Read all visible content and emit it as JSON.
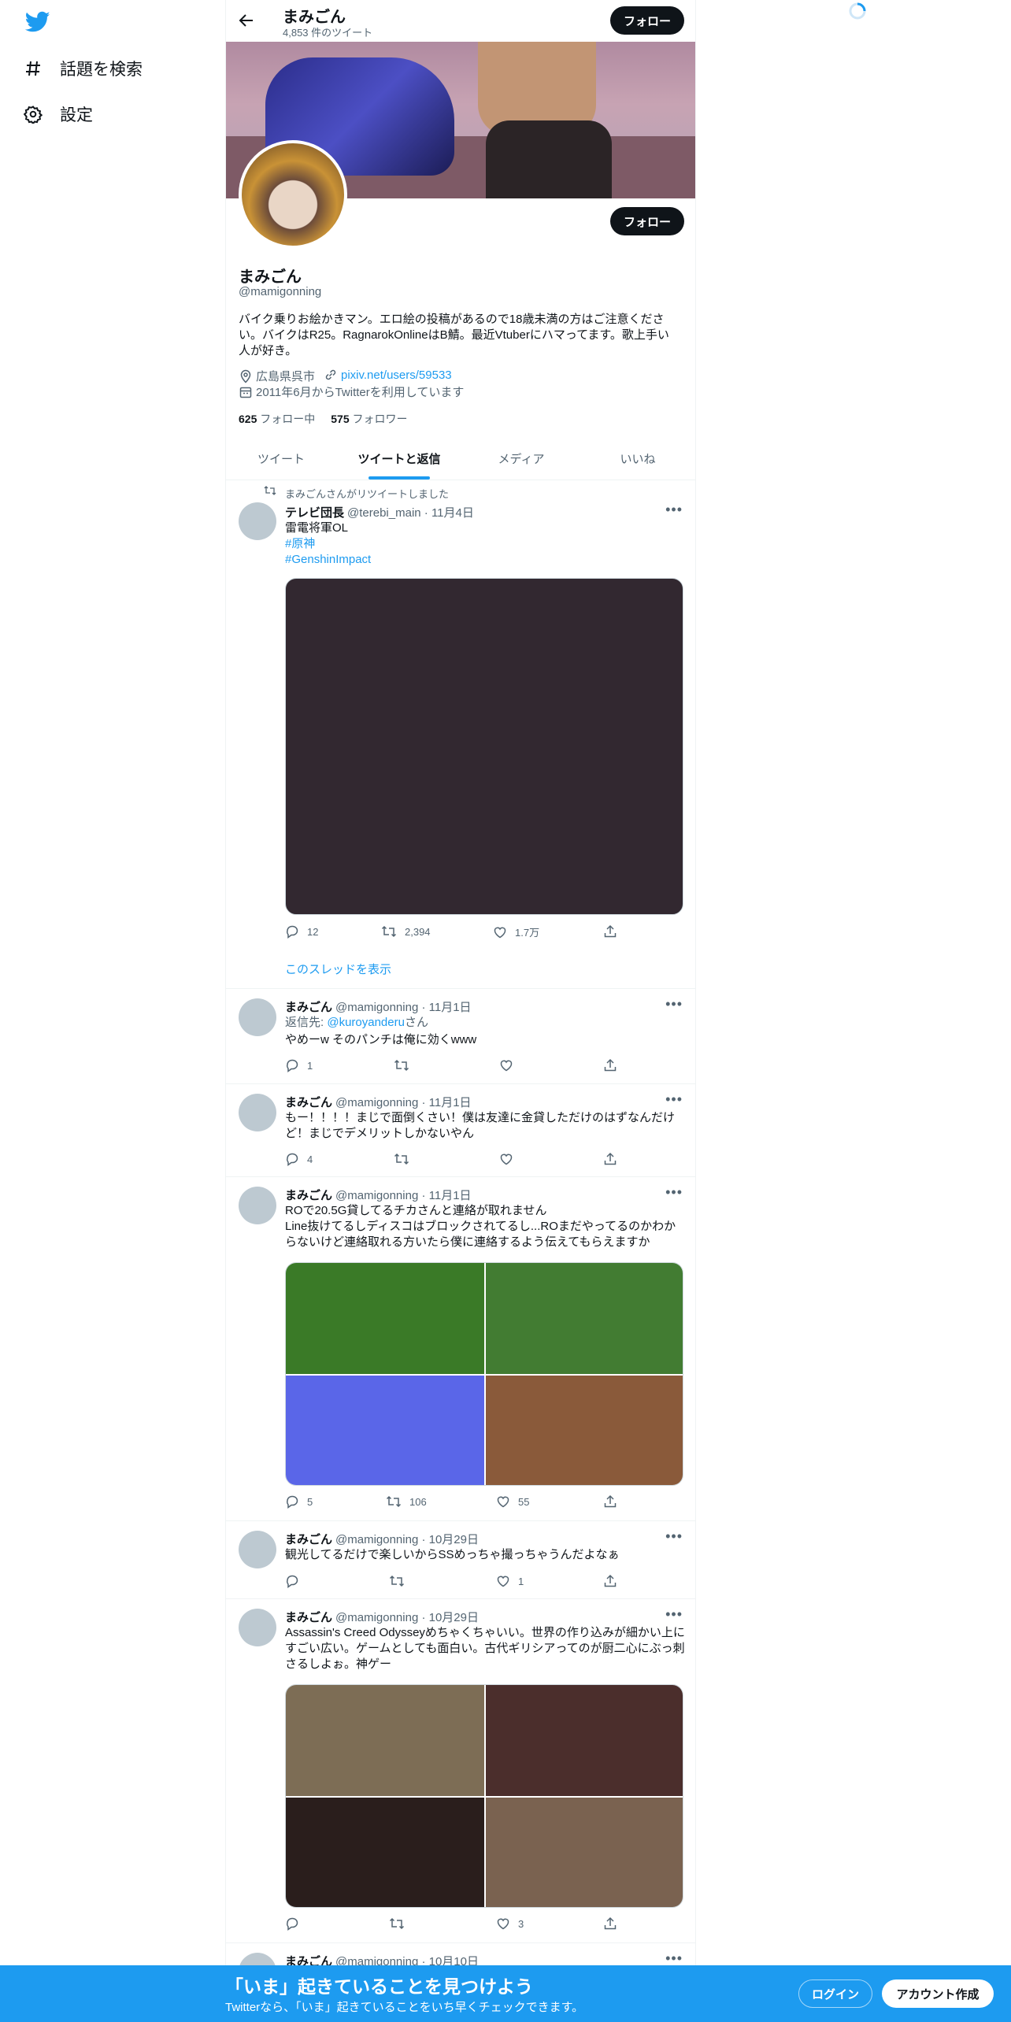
{
  "nav": {
    "explore_label": "話題を検索",
    "settings_label": "設定"
  },
  "header": {
    "name": "まみごん",
    "tweet_count": "4,853 件のツイート",
    "follow_label": "フォロー"
  },
  "profile": {
    "follow_label": "フォロー",
    "name": "まみごん",
    "handle": "@mamigonning",
    "bio": "バイク乗りお絵かきマン。エロ絵の投稿があるので18歳未満の方はご注意ください。バイクはR25。RagnarokOnlineはB鯖。最近Vtuberにハマってます。歌上手い人が好き。",
    "location": "広島県呉市",
    "link": "pixiv.net/users/59533",
    "joined": "2011年6月からTwitterを利用しています",
    "following_count": "625",
    "following_label": "フォロー中",
    "followers_count": "575",
    "followers_label": "フォロワー"
  },
  "tabs": [
    {
      "label": "ツイート",
      "active": false
    },
    {
      "label": "ツイートと返信",
      "active": true
    },
    {
      "label": "メディア",
      "active": false
    },
    {
      "label": "いいね",
      "active": false
    }
  ],
  "tweets": [
    {
      "retweet_note": "まみごんさんがリツイートしました",
      "name": "テレビ団長",
      "meta": "@terebi_main · 11月4日",
      "text_line1": "雷電将軍OL",
      "hashtag1": "#原神",
      "hashtag2": "#GenshinImpact",
      "replies": "12",
      "retweets": "2,394",
      "likes": "1.7万",
      "show_thread": "このスレッドを表示"
    },
    {
      "name": "まみごん",
      "meta": "@mamigonning · 11月1日",
      "reply_prefix": "返信先: ",
      "reply_to": "@kuroyanderu",
      "reply_suffix": "さん",
      "text": "やめーw そのパンチは俺に効くwww",
      "replies": "1",
      "retweets": "",
      "likes": ""
    },
    {
      "name": "まみごん",
      "meta": "@mamigonning · 11月1日",
      "text": "もー！！！！まじで面倒くさい！僕は友達に金貸しただけのはずなんだけど！まじでデメリットしかないやん",
      "replies": "4",
      "retweets": "",
      "likes": ""
    },
    {
      "name": "まみごん",
      "meta": "@mamigonning · 11月1日",
      "text_line1": "ROで20.5G貸してるチカさんと連絡が取れません",
      "text_line2": "Line抜けてるしディスコはブロックされてるし...ROまだやってるのかわからないけど連絡取れる方いたら僕に連絡するよう伝えてもらえますか",
      "replies": "5",
      "retweets": "106",
      "likes": "55"
    },
    {
      "name": "まみごん",
      "meta": "@mamigonning · 10月29日",
      "text": "観光してるだけで楽しいからSSめっちゃ撮っちゃうんだよなぁ",
      "replies": "",
      "retweets": "",
      "likes": "1"
    },
    {
      "name": "まみごん",
      "meta": "@mamigonning · 10月29日",
      "text": "Assassin's Creed Odysseyめちゃくちゃいい。世界の作り込みが細かい上にすごい広い。ゲームとしても面白い。古代ギリシアってのが厨二心にぶっ刺さるしよぉ。神ゲー",
      "replies": "",
      "retweets": "",
      "likes": "3"
    },
    {
      "name": "まみごん",
      "meta": "@mamigonning · 10月10日"
    }
  ],
  "banner": {
    "title": "「いま」起きていることを見つけよう",
    "subtitle": "Twitterなら、「いま」起きていることをいち早くチェックできます。",
    "login_label": "ログイン",
    "signup_label": "アカウント作成"
  },
  "colors": {
    "accent": "#1d9bf0",
    "text": "#0f1419",
    "muted": "#536471",
    "media_tweet1": "#322830",
    "media_tweet4": [
      "#3a7a27",
      "#427c32",
      "#5a66e8",
      "#8a5a3a"
    ],
    "media_tweet6": [
      "#7d6d55",
      "#4b2e2c",
      "#2a1e1c",
      "#7a6250"
    ]
  },
  "icons": [
    "twitter-logo-icon",
    "hashtag-icon",
    "gear-icon",
    "back-arrow-icon",
    "location-icon",
    "link-icon",
    "calendar-icon",
    "retweet-icon",
    "reply-icon",
    "like-icon",
    "share-icon",
    "more-icon",
    "loading-spinner-icon"
  ]
}
